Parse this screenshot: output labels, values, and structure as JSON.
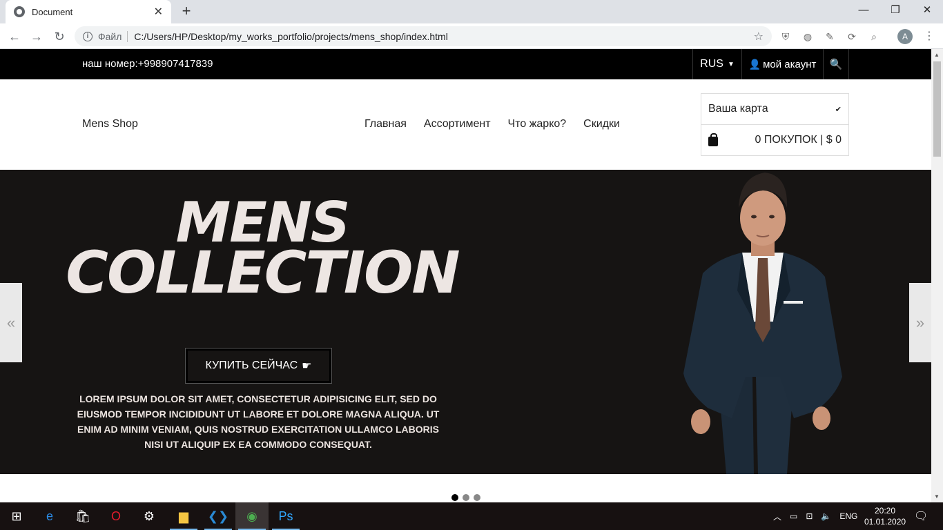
{
  "browser": {
    "tab_title": "Document",
    "tab_close": "✕",
    "new_tab": "+",
    "scheme": "Файл",
    "url": "C:/Users/HP/Desktop/my_works_portfolio/projects/mens_shop/index.html",
    "profile_initial": "A",
    "minimize": "—",
    "maximize": "❐",
    "close": "✕"
  },
  "topbar": {
    "phone": "наш номер:+998907417839",
    "language": "RUS",
    "account": "мой акаунт"
  },
  "header": {
    "logo": "Mens Shop",
    "nav": [
      "Главная",
      "Ассортимент",
      "Что жарко?",
      "Скидки"
    ],
    "cart_title": "Ваша карта",
    "cart_summary": "0 ПОКУПОК | $ 0"
  },
  "hero": {
    "title_line1": "MENS",
    "title_line2": "COLLECTION",
    "button": "КУПИТЬ СЕЙЧАС",
    "button_icon": "☛",
    "description": "LOREM IPSUM DOLOR SIT AMET, CONSECTETUR ADIPISICING ELIT, SED DO EIUSMOD TEMPOR INCIDIDUNT UT LABORE ET DOLORE MAGNA ALIQUA. UT ENIM AD MINIM VENIAM, QUIS NOSTRUD EXERCITATION ULLAMCO LABORIS NISI UT ALIQUIP EX EA COMMODO CONSEQUAT.",
    "prev": "«",
    "next": "»",
    "slides": 3,
    "active_slide": 1
  },
  "taskbar": {
    "language": "ENG",
    "time": "20:20",
    "date": "01.01.2020"
  },
  "colors": {
    "hero_bg": "#161413",
    "topbar_bg": "#000000",
    "hero_text": "#ede6e3"
  }
}
